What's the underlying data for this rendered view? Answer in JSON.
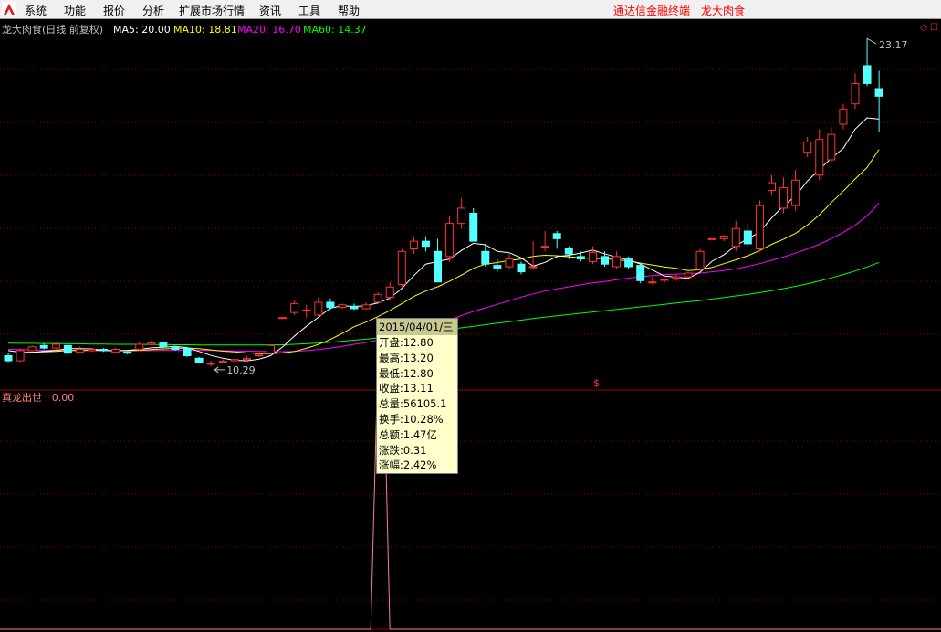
{
  "menu": {
    "items": [
      "系统",
      "功能",
      "报价",
      "分析",
      "扩展市场行情",
      "资讯",
      "工具",
      "帮助"
    ],
    "right": [
      "通达信金融终端",
      "龙大肉食"
    ]
  },
  "header": {
    "title": "龙大肉食(日线 前复权)",
    "ma": [
      {
        "label": "MA5: 20.00",
        "color": "#ffffff"
      },
      {
        "label": "MA10: 18.81",
        "color": "#ffff00"
      },
      {
        "label": "MA20: 16.70",
        "color": "#ff00ff"
      },
      {
        "label": "MA60: 14.37",
        "color": "#00ff00"
      }
    ]
  },
  "annotations": {
    "high": "23.17",
    "low": "10.29"
  },
  "indicator": {
    "label": "真龙出世 : 0.00"
  },
  "tooltip": {
    "date": "2015/04/01/三",
    "rows": [
      "开盘:12.80",
      "最高:13.20",
      "最低:12.80",
      "收盘:13.11",
      "总量:56105.1",
      "换手:10.28%",
      "总额:1.47亿",
      "涨跌:0.31",
      "涨幅:2.42%"
    ]
  },
  "colors": {
    "up": "#ff3232",
    "down": "#54ffff",
    "ma5": "#ffffff",
    "ma10": "#ffff00",
    "ma20": "#ff00ff",
    "ma60": "#00ff00",
    "grid": "#8b0000"
  },
  "chart_data": {
    "type": "candlestick",
    "ylim": [
      10.0,
      24.0
    ],
    "candles": [
      [
        10.7,
        10.5,
        10.78,
        10.45
      ],
      [
        10.5,
        10.9,
        10.98,
        10.45
      ],
      [
        10.9,
        11.05,
        11.1,
        10.85
      ],
      [
        11.1,
        11.0,
        11.2,
        10.95
      ],
      [
        11.0,
        11.15,
        11.25,
        10.95
      ],
      [
        11.1,
        10.8,
        11.15,
        10.75
      ],
      [
        10.85,
        10.95,
        11.05,
        10.8
      ],
      [
        10.9,
        10.95,
        11.0,
        10.85
      ],
      [
        10.95,
        10.9,
        11.0,
        10.85
      ],
      [
        10.85,
        10.95,
        11.0,
        10.8
      ],
      [
        10.85,
        10.8,
        10.9,
        10.75
      ],
      [
        10.95,
        11.15,
        11.25,
        10.9
      ],
      [
        11.15,
        11.2,
        11.3,
        11.1
      ],
      [
        11.2,
        11.05,
        11.25,
        11.0
      ],
      [
        11.05,
        10.95,
        11.1,
        10.9
      ],
      [
        11.0,
        10.7,
        11.05,
        10.65
      ],
      [
        10.6,
        10.45,
        10.65,
        10.4
      ],
      [
        10.4,
        10.4,
        10.5,
        10.29
      ],
      [
        10.45,
        10.48,
        10.55,
        10.4
      ],
      [
        10.5,
        10.55,
        10.6,
        10.45
      ],
      [
        10.55,
        10.6,
        10.7,
        10.5
      ],
      [
        10.7,
        10.75,
        10.8,
        10.65
      ],
      [
        10.8,
        11.1,
        11.15,
        10.75
      ],
      [
        12.2,
        12.2,
        12.2,
        12.2
      ],
      [
        12.4,
        12.75,
        12.9,
        12.3
      ],
      [
        12.5,
        12.5,
        12.7,
        12.2
      ],
      [
        12.3,
        12.8,
        13.0,
        12.25
      ],
      [
        12.8,
        12.6,
        12.95,
        12.5
      ],
      [
        12.6,
        12.7,
        12.75,
        12.55
      ],
      [
        12.65,
        12.55,
        12.75,
        12.5
      ],
      [
        12.55,
        12.7,
        12.8,
        12.5
      ],
      [
        12.8,
        13.11,
        13.2,
        12.8
      ],
      [
        13.0,
        13.4,
        13.6,
        12.9
      ],
      [
        13.5,
        14.8,
        14.9,
        13.4
      ],
      [
        14.9,
        15.2,
        15.4,
        14.7
      ],
      [
        15.2,
        15.0,
        15.4,
        14.8
      ],
      [
        14.8,
        13.6,
        15.3,
        13.6
      ],
      [
        14.6,
        15.9,
        16.2,
        14.4
      ],
      [
        15.9,
        16.5,
        16.9,
        15.7
      ],
      [
        16.3,
        15.2,
        16.5,
        15.2
      ],
      [
        14.8,
        14.3,
        15.1,
        14.2
      ],
      [
        14.25,
        14.15,
        14.5,
        14.0
      ],
      [
        14.2,
        14.5,
        14.7,
        14.1
      ],
      [
        14.3,
        14.0,
        14.4,
        13.9
      ],
      [
        14.2,
        14.2,
        15.2,
        14.1
      ],
      [
        15.0,
        15.0,
        15.6,
        14.8
      ],
      [
        15.5,
        15.3,
        15.6,
        14.9
      ],
      [
        14.9,
        14.7,
        15.0,
        14.5
      ],
      [
        14.6,
        14.5,
        14.8,
        14.4
      ],
      [
        14.4,
        14.75,
        15.0,
        14.3
      ],
      [
        14.6,
        14.3,
        14.8,
        14.2
      ],
      [
        14.2,
        14.6,
        14.8,
        14.1
      ],
      [
        14.5,
        14.2,
        14.6,
        14.1
      ],
      [
        14.25,
        13.65,
        14.3,
        13.55
      ],
      [
        13.6,
        13.6,
        13.8,
        13.5
      ],
      [
        13.7,
        13.7,
        13.85,
        13.55
      ],
      [
        13.75,
        13.8,
        13.9,
        13.65
      ],
      [
        13.8,
        13.95,
        14.0,
        13.75
      ],
      [
        14.1,
        14.8,
        14.9,
        14.0
      ],
      [
        15.3,
        15.3,
        15.3,
        15.3
      ],
      [
        15.3,
        15.4,
        15.45,
        15.2
      ],
      [
        15.0,
        15.7,
        16.0,
        14.8
      ],
      [
        15.6,
        15.1,
        15.9,
        15.0
      ],
      [
        14.9,
        16.6,
        16.8,
        14.8
      ],
      [
        17.2,
        17.5,
        17.8,
        17.0
      ],
      [
        16.5,
        17.3,
        17.7,
        16.3
      ],
      [
        16.6,
        17.6,
        18.0,
        16.4
      ],
      [
        18.7,
        19.1,
        19.3,
        18.5
      ],
      [
        17.8,
        19.2,
        19.6,
        17.6
      ],
      [
        18.4,
        19.4,
        19.7,
        18.3
      ],
      [
        19.8,
        20.4,
        20.6,
        19.6
      ],
      [
        20.6,
        21.4,
        21.8,
        20.4
      ],
      [
        22.1,
        21.4,
        23.17,
        21.3
      ],
      [
        21.2,
        20.9,
        21.9,
        19.5
      ]
    ],
    "ma5": [
      10.9,
      10.84,
      10.83,
      10.88,
      10.91,
      10.98,
      10.98,
      10.97,
      10.91,
      10.89,
      10.91,
      10.95,
      11.01,
      11.03,
      11.07,
      11.02,
      10.87,
      10.71,
      10.6,
      10.52,
      10.5,
      10.56,
      10.7,
      11.04,
      11.48,
      11.86,
      12.21,
      12.57,
      12.67,
      12.63,
      12.67,
      12.77,
      12.96,
      13.35,
      13.85,
      14.3,
      14.4,
      14.5,
      14.84,
      15.12,
      15.06,
      14.8,
      14.75,
      14.55,
      14.22,
      14.37,
      14.6,
      14.65,
      14.74,
      14.85,
      14.71,
      14.57,
      14.47,
      14.3,
      14.07,
      13.83,
      13.79,
      13.74,
      13.98,
      14.41,
      14.67,
      15.03,
      15.3,
      15.56,
      16.12,
      16.6,
      16.97,
      17.57,
      18.02,
      18.46,
      18.85,
      19.61,
      20.05,
      20.0
    ],
    "ma10": [
      10.8,
      10.82,
      10.84,
      10.85,
      10.87,
      10.9,
      10.91,
      10.91,
      10.91,
      10.9,
      10.9,
      10.91,
      10.94,
      10.97,
      10.99,
      11.0,
      10.98,
      10.93,
      10.88,
      10.85,
      10.81,
      10.79,
      10.78,
      10.81,
      10.87,
      10.99,
      11.14,
      11.34,
      11.58,
      11.84,
      12.02,
      12.24,
      12.48,
      12.75,
      13.03,
      13.24,
      13.41,
      13.63,
      13.87,
      14.14,
      14.3,
      14.36,
      14.44,
      14.5,
      14.61,
      14.65,
      14.63,
      14.59,
      14.55,
      14.52,
      14.52,
      14.47,
      14.43,
      14.34,
      14.27,
      14.19,
      14.14,
      14.05,
      14.08,
      14.17,
      14.32,
      14.47,
      14.63,
      14.83,
      15.08,
      15.28,
      15.51,
      15.84,
      16.23,
      16.72,
      17.17,
      17.65,
      18.1,
      18.81
    ],
    "ma20": [
      10.95,
      10.94,
      10.93,
      10.92,
      10.92,
      10.91,
      10.91,
      10.9,
      10.9,
      10.9,
      10.9,
      10.9,
      10.9,
      10.91,
      10.91,
      10.91,
      10.91,
      10.91,
      10.9,
      10.89,
      10.88,
      10.87,
      10.86,
      10.86,
      10.87,
      10.9,
      10.94,
      11.0,
      11.07,
      11.15,
      11.22,
      11.31,
      11.41,
      11.53,
      11.67,
      11.81,
      11.95,
      12.11,
      12.28,
      12.44,
      12.58,
      12.72,
      12.86,
      13.0,
      13.13,
      13.24,
      13.33,
      13.41,
      13.49,
      13.56,
      13.62,
      13.69,
      13.75,
      13.8,
      13.85,
      13.89,
      13.91,
      13.92,
      13.95,
      14.0,
      14.05,
      14.12,
      14.21,
      14.32,
      14.45,
      14.58,
      14.73,
      14.9,
      15.08,
      15.3,
      15.55,
      15.83,
      16.2,
      16.7
    ],
    "ma60": [
      11.2,
      11.19,
      11.19,
      11.18,
      11.18,
      11.17,
      11.17,
      11.16,
      11.16,
      11.15,
      11.15,
      11.15,
      11.14,
      11.14,
      11.13,
      11.13,
      11.12,
      11.12,
      11.12,
      11.12,
      11.12,
      11.12,
      11.12,
      11.13,
      11.15,
      11.17,
      11.2,
      11.23,
      11.27,
      11.31,
      11.35,
      11.4,
      11.45,
      11.5,
      11.56,
      11.62,
      11.68,
      11.74,
      11.8,
      11.86,
      11.92,
      11.98,
      12.04,
      12.1,
      12.16,
      12.22,
      12.27,
      12.32,
      12.37,
      12.42,
      12.47,
      12.52,
      12.57,
      12.62,
      12.67,
      12.72,
      12.77,
      12.82,
      12.87,
      12.93,
      12.99,
      13.05,
      13.11,
      13.18,
      13.26,
      13.34,
      13.43,
      13.53,
      13.64,
      13.76,
      13.89,
      14.03,
      14.19,
      14.37
    ],
    "selected_index": 31,
    "indicator_spike_index": 31
  }
}
